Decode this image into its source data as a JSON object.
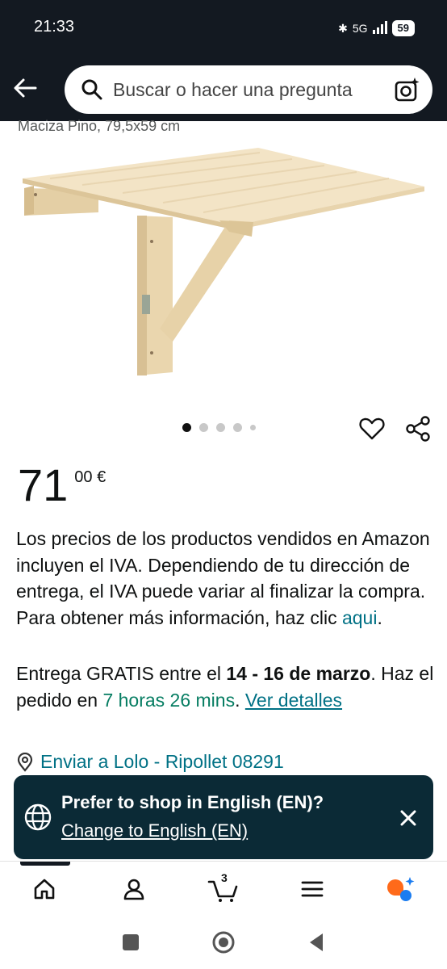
{
  "status_bar": {
    "time": "21:33",
    "network": "5G",
    "battery": "59"
  },
  "search": {
    "placeholder": "Buscar o hacer una pregunta"
  },
  "product": {
    "subtitle": "Maciza Pino, 79,5x59 cm",
    "image_alt": "Mesa plegable de pared de madera de pino",
    "gallery": {
      "count": 5,
      "active_index": 0
    },
    "price": {
      "whole": "71",
      "fraction": "00 €"
    }
  },
  "vat_notice": {
    "text": "Los precios de los productos vendidos en Amazon incluyen el IVA. Dependiendo de tu dirección de entrega, el IVA puede variar al finalizar la compra. Para obtener más información, haz clic ",
    "link": "aqui",
    "end": "."
  },
  "delivery": {
    "prefix": "Entrega GRATIS entre el ",
    "dates": "14 - 16 de marzo",
    "middle": ". Haz el pedido en ",
    "countdown": "7 horas 26 mins",
    "suffix": ". ",
    "details_link": "Ver detalles"
  },
  "ship_to": {
    "text": "Enviar a Lolo - Ripollet 08291"
  },
  "language_banner": {
    "title": "Prefer to shop in English (EN)?",
    "link": "Change to English (EN)"
  },
  "bottom_nav": {
    "items": [
      "home-icon",
      "account-icon",
      "cart-icon",
      "menu-icon",
      "rufus-icon"
    ],
    "cart_count": "3"
  },
  "colors": {
    "header_bg": "#131921",
    "link": "#007185",
    "green": "#067d62",
    "banner_bg": "#0b2a36"
  }
}
